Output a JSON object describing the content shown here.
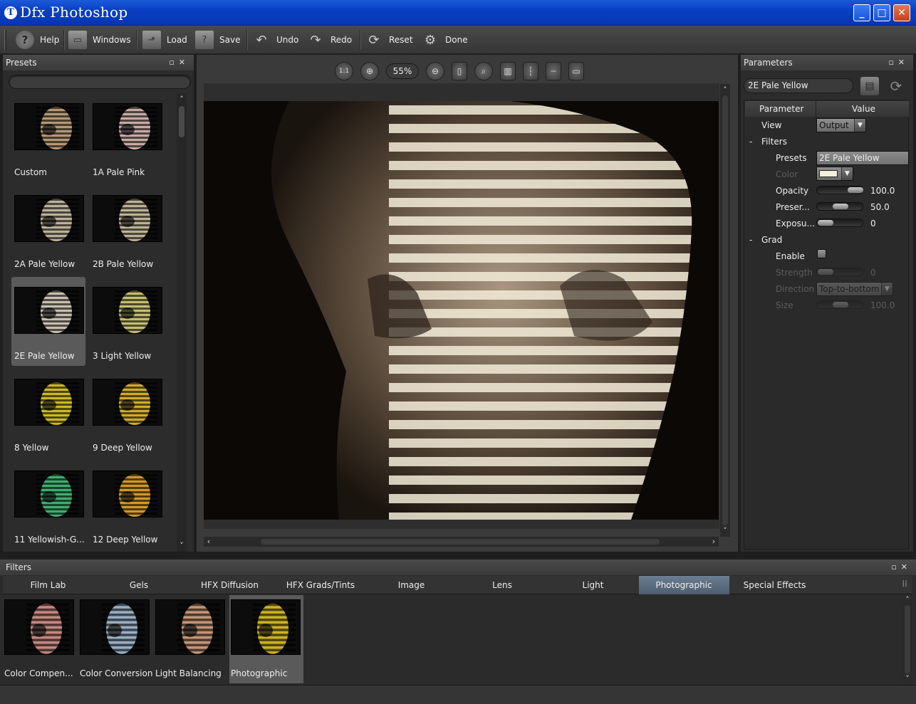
{
  "window": {
    "title": "Dfx Photoshop",
    "logo_letter": "T",
    "controls": [
      "_",
      "□",
      "✕"
    ]
  },
  "toolbar": [
    {
      "label": "Help",
      "icon": "help-icon",
      "glyph": "?"
    },
    {
      "label": "Windows",
      "icon": "windows-icon",
      "glyph": "▭"
    },
    {
      "label": "Load",
      "icon": "load-icon",
      "glyph": "⬏"
    },
    {
      "label": "Save",
      "icon": "save-icon",
      "glyph": "?"
    },
    {
      "label": "Undo",
      "icon": "undo-icon",
      "glyph": "↶"
    },
    {
      "label": "Redo",
      "icon": "redo-icon",
      "glyph": "↷"
    },
    {
      "label": "Reset",
      "icon": "reset-icon",
      "glyph": "⟳"
    },
    {
      "label": "Done",
      "icon": "done-icon",
      "glyph": "⚙"
    }
  ],
  "presets": {
    "title": "Presets",
    "items": [
      {
        "label": "Custom",
        "tint": "#c8a77e",
        "selected": false
      },
      {
        "label": "1A Pale Pink",
        "tint": "#dcbcb4",
        "selected": false
      },
      {
        "label": "2A Pale Yellow",
        "tint": "#cfc3a8",
        "selected": false
      },
      {
        "label": "2B Pale Yellow",
        "tint": "#d2c4a2",
        "selected": false
      },
      {
        "label": "2E Pale Yellow",
        "tint": "#dcd4c0",
        "selected": true
      },
      {
        "label": "3 Light Yellow",
        "tint": "#d8d27a",
        "selected": false
      },
      {
        "label": "8 Yellow",
        "tint": "#e2cc28",
        "selected": false
      },
      {
        "label": "9 Deep Yellow",
        "tint": "#e8bc30",
        "selected": false
      },
      {
        "label": "11 Yellowish-G...",
        "tint": "#46c07a",
        "selected": false
      },
      {
        "label": "12 Deep Yellow",
        "tint": "#e8a828",
        "selected": false
      }
    ]
  },
  "canvas": {
    "zoom": "55%",
    "one_to_one": "1:1"
  },
  "parameters": {
    "title": "Parameters",
    "preset_name": "2E Pale Yellow",
    "col_parameter": "Parameter",
    "col_value": "Value",
    "view_label": "View",
    "view_value": "Output",
    "filters_group": "Filters",
    "presets_label": "Presets",
    "presets_value": "2E Pale Yellow",
    "color_label": "Color",
    "color_value": "#f4f0dc",
    "opacity_label": "Opacity",
    "opacity_value": "100.0",
    "opacity_level": 1.0,
    "preserve_label": "Preser...",
    "preserve_value": "50.0",
    "preserve_level": 0.5,
    "exposure_label": "Exposu...",
    "exposure_value": "0",
    "exposure_level": 0.0,
    "grad_group": "Grad",
    "enable_label": "Enable",
    "enable_checked": false,
    "strength_label": "Strength",
    "strength_value": "0",
    "direction_label": "Direction",
    "direction_value": "Top-to-bottom",
    "size_label": "Size",
    "size_value": "100.0",
    "expand_glyph": "-"
  },
  "filters": {
    "title": "Filters",
    "tabs": [
      "Film Lab",
      "Gels",
      "HFX Diffusion",
      "HFX Grads/Tints",
      "Image",
      "Lens",
      "Light",
      "Photographic",
      "Special Effects"
    ],
    "active_tab": "Photographic",
    "items": [
      {
        "label": "Color Compen...",
        "tint": "#d8968c"
      },
      {
        "label": "Color Conversion",
        "tint": "#a8c0d8"
      },
      {
        "label": "Light Balancing",
        "tint": "#d8a482"
      },
      {
        "label": "Photographic",
        "tint": "#e2c426"
      }
    ]
  },
  "panel_controls": {
    "float": "▫",
    "close": "✕"
  },
  "scroll": {
    "up": "˄",
    "down": "˅",
    "left": "‹",
    "right": "›"
  }
}
